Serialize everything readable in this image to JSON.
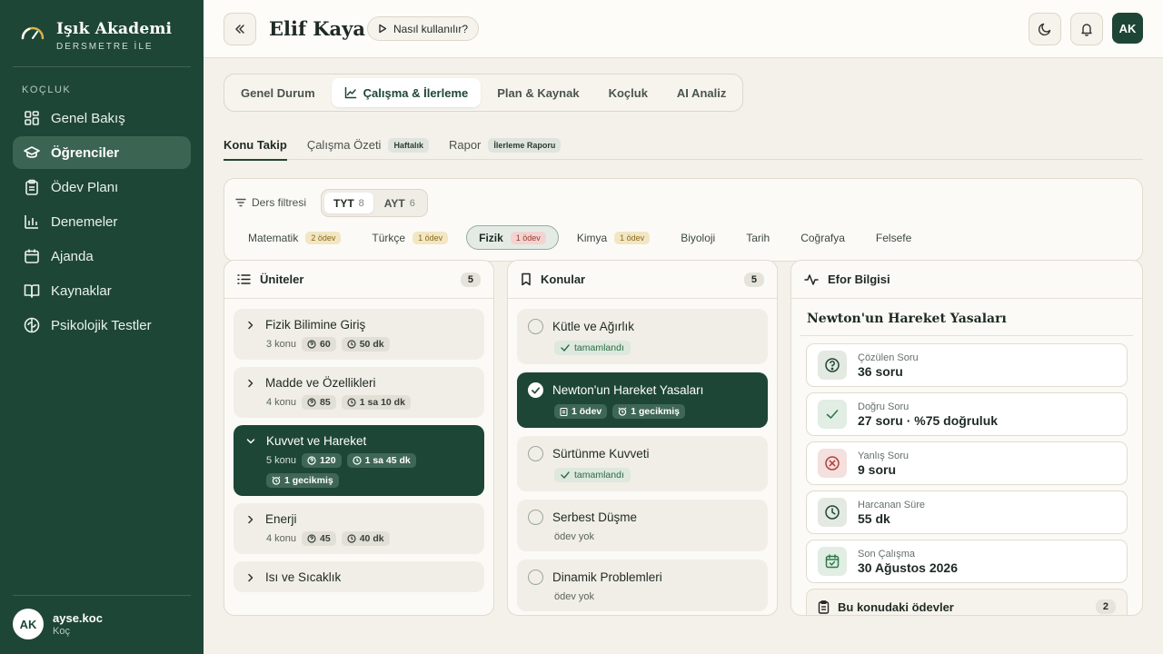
{
  "brand": {
    "name": "Işık Akademi",
    "subtitle": "DERSMETRE İLE"
  },
  "sidebar": {
    "section": "KOÇLUK",
    "items": [
      {
        "label": "Genel Bakış",
        "icon": "grid-icon"
      },
      {
        "label": "Öğrenciler",
        "icon": "graduation-cap-icon"
      },
      {
        "label": "Ödev Planı",
        "icon": "clipboard-icon"
      },
      {
        "label": "Denemeler",
        "icon": "bar-chart-icon"
      },
      {
        "label": "Ajanda",
        "icon": "calendar-icon"
      },
      {
        "label": "Kaynaklar",
        "icon": "book-open-icon"
      },
      {
        "label": "Psikolojik Testler",
        "icon": "brain-icon"
      }
    ],
    "user": {
      "initials": "AK",
      "name": "ayse.koc",
      "role": "Koç"
    }
  },
  "topbar": {
    "title": "Elif Kaya",
    "help": "Nasıl kullanılır?",
    "avatar": "AK"
  },
  "main_tabs": [
    "Genel Durum",
    "Çalışma & İlerleme",
    "Plan & Kaynak",
    "Koçluk",
    "AI Analiz"
  ],
  "sub_tabs": {
    "takip": "Konu Takip",
    "ozet": "Çalışma Özeti",
    "ozet_badge": "Haftalık",
    "rapor": "Rapor",
    "rapor_badge": "İlerleme Raporu"
  },
  "filter": {
    "label": "Ders filtresi",
    "tyt": "TYT",
    "tyt_count": "8",
    "ayt": "AYT",
    "ayt_count": "6",
    "subjects": [
      {
        "name": "Matematik",
        "badge": "2 ödev"
      },
      {
        "name": "Türkçe",
        "badge": "1 ödev"
      },
      {
        "name": "Fizik",
        "badge": "1 ödev"
      },
      {
        "name": "Kimya",
        "badge": "1 ödev"
      },
      {
        "name": "Biyoloji",
        "badge": ""
      },
      {
        "name": "Tarih",
        "badge": ""
      },
      {
        "name": "Coğrafya",
        "badge": ""
      },
      {
        "name": "Felsefe",
        "badge": ""
      }
    ]
  },
  "units": {
    "title": "Üniteler",
    "count": "5",
    "items": [
      {
        "title": "Fizik Bilimine Giriş",
        "topics": "3 konu",
        "questions": "60",
        "time": "50 dk"
      },
      {
        "title": "Madde ve Özellikleri",
        "topics": "4 konu",
        "questions": "85",
        "time": "1 sa 10 dk"
      },
      {
        "title": "Kuvvet ve Hareket",
        "topics": "5 konu",
        "questions": "120",
        "time": "1 sa 45 dk",
        "late": "1 gecikmiş"
      },
      {
        "title": "Enerji",
        "topics": "4 konu",
        "questions": "45",
        "time": "40 dk"
      },
      {
        "title": "Isı ve Sıcaklık"
      }
    ]
  },
  "topics": {
    "title": "Konular",
    "count": "5",
    "items": [
      {
        "title": "Kütle ve Ağırlık",
        "status": "tamamlandı"
      },
      {
        "title": "Newton'un Hareket Yasaları",
        "hw": "1 ödev",
        "late": "1 gecikmiş"
      },
      {
        "title": "Sürtünme Kuvveti",
        "status": "tamamlandı"
      },
      {
        "title": "Serbest Düşme",
        "note": "ödev yok"
      },
      {
        "title": "Dinamik Problemleri",
        "note": "ödev yok"
      }
    ]
  },
  "effort": {
    "header": "Efor Bilgisi",
    "topic": "Newton'un Hareket Yasaları",
    "items": [
      {
        "label": "Çözülen Soru",
        "value": "36 soru",
        "icon": "question-circle-icon"
      },
      {
        "label": "Doğru Soru",
        "value": "27 soru · %75 doğruluk",
        "icon": "check-icon"
      },
      {
        "label": "Yanlış Soru",
        "value": "9 soru",
        "icon": "x-circle-icon"
      },
      {
        "label": "Harcanan Süre",
        "value": "55 dk",
        "icon": "clock-icon"
      },
      {
        "label": "Son Çalışma",
        "value": "30 Ağustos 2026",
        "icon": "calendar-check-icon"
      }
    ],
    "homework_label": "Bu konudaki ödevler",
    "homework_count": "2"
  }
}
